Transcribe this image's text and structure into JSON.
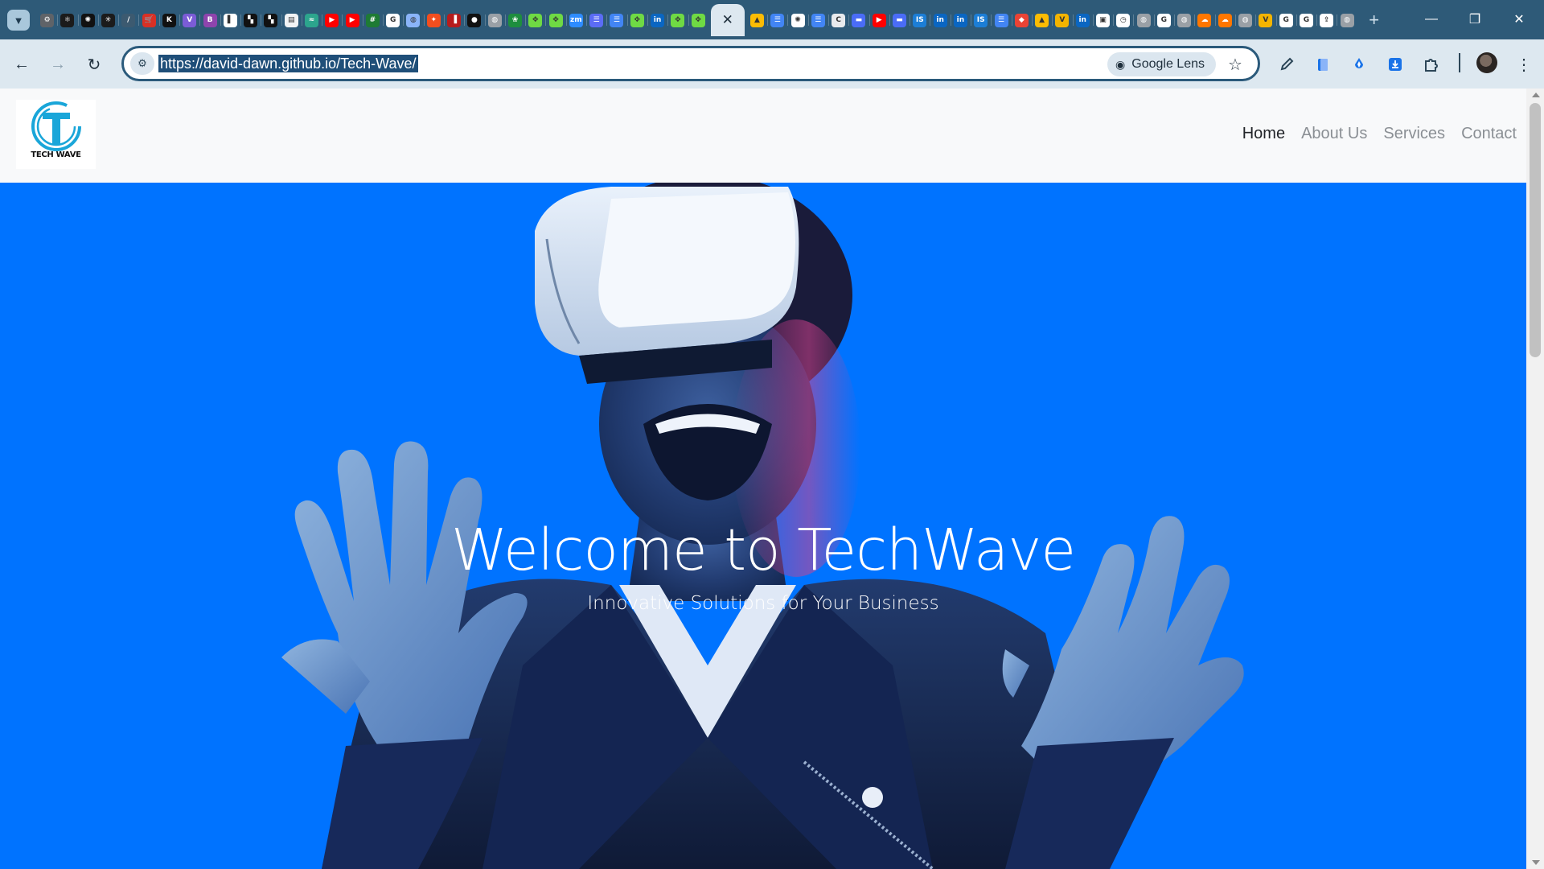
{
  "browser": {
    "pinned_tabs": [
      {
        "icon": "settings-gear-icon",
        "color": "#5f6368",
        "glyph": "⚙"
      },
      {
        "icon": "react-icon",
        "color": "#1b1b1b",
        "glyph": "⚛"
      },
      {
        "icon": "chatgpt-icon",
        "color": "#111111",
        "glyph": "✺"
      },
      {
        "icon": "perplexity-icon",
        "color": "#1b1b1b",
        "glyph": "✳"
      },
      {
        "icon": "slash-icon",
        "color": "#3c5a70",
        "glyph": "/"
      },
      {
        "icon": "shopping-cart-icon",
        "color": "#d93025",
        "glyph": "🛒"
      },
      {
        "icon": "k-icon",
        "color": "#111111",
        "glyph": "K"
      },
      {
        "icon": "v-icon",
        "color": "#7b5cd6",
        "glyph": "V"
      },
      {
        "icon": "b-icon",
        "color": "#8e44ad",
        "glyph": "B"
      },
      {
        "icon": "notion-icon",
        "color": "#ffffff",
        "glyph": "▌"
      },
      {
        "icon": "workspace-icon",
        "color": "#111111",
        "glyph": "▚"
      },
      {
        "icon": "workspace-icon",
        "color": "#111111",
        "glyph": "▚"
      },
      {
        "icon": "document-icon",
        "color": "#f1f3f4",
        "glyph": "▤"
      },
      {
        "icon": "wave-icon",
        "color": "#2ca58d",
        "glyph": "≈"
      },
      {
        "icon": "youtube-icon",
        "color": "#ff0000",
        "glyph": "▶"
      },
      {
        "icon": "youtube-icon",
        "color": "#ff0000",
        "glyph": "▶"
      },
      {
        "icon": "grid-icon",
        "color": "#1e7b34",
        "glyph": "#"
      },
      {
        "icon": "google-icon",
        "color": "#ffffff",
        "glyph": "G"
      },
      {
        "icon": "globe-icon",
        "color": "#8ab4f8",
        "glyph": "◍"
      },
      {
        "icon": "figma-icon",
        "color": "#f24e1e",
        "glyph": "✦"
      },
      {
        "icon": "red-icon",
        "color": "#b71c1c",
        "glyph": "▐"
      },
      {
        "icon": "github-icon",
        "color": "#111111",
        "glyph": "●"
      },
      {
        "icon": "globe-icon",
        "color": "#9aa0a6",
        "glyph": "◍"
      },
      {
        "icon": "leaf-icon",
        "color": "#1e8e3e",
        "glyph": "❀"
      },
      {
        "icon": "upwork-icon",
        "color": "#6fda44",
        "glyph": "✥"
      },
      {
        "icon": "upwork-icon",
        "color": "#6fda44",
        "glyph": "✥"
      },
      {
        "icon": "zoom-icon",
        "color": "#2d8cff",
        "glyph": "zm"
      },
      {
        "icon": "list-icon",
        "color": "#5b6cf5",
        "glyph": "☰"
      },
      {
        "icon": "google-docs-icon",
        "color": "#4285f4",
        "glyph": "☰"
      },
      {
        "icon": "upwork-icon",
        "color": "#6fda44",
        "glyph": "✥"
      },
      {
        "icon": "linkedin-icon",
        "color": "#0a66c2",
        "glyph": "in"
      },
      {
        "icon": "upwork-icon",
        "color": "#6fda44",
        "glyph": "✥"
      },
      {
        "icon": "upwork-icon",
        "color": "#6fda44",
        "glyph": "✥"
      }
    ],
    "pinned_tabs_right": [
      {
        "icon": "google-drive-icon",
        "color": "#fbbc04",
        "glyph": "▲"
      },
      {
        "icon": "google-docs-icon",
        "color": "#4285f4",
        "glyph": "☰"
      },
      {
        "icon": "chatgpt-icon",
        "color": "#ffffff",
        "glyph": "✺"
      },
      {
        "icon": "google-docs-icon",
        "color": "#4285f4",
        "glyph": "☰"
      },
      {
        "icon": "c-icon",
        "color": "#e8eaed",
        "glyph": "C"
      },
      {
        "icon": "bar-icon",
        "color": "#4a6cf7",
        "glyph": "▬"
      },
      {
        "icon": "youtube-icon",
        "color": "#ff0000",
        "glyph": "▶"
      },
      {
        "icon": "bar-icon",
        "color": "#4a6cf7",
        "glyph": "▬"
      },
      {
        "icon": "is-icon",
        "color": "#1c7ed6",
        "glyph": "IS"
      },
      {
        "icon": "linkedin-icon",
        "color": "#0a66c2",
        "glyph": "in"
      },
      {
        "icon": "linkedin-icon",
        "color": "#0a66c2",
        "glyph": "in"
      },
      {
        "icon": "is-icon",
        "color": "#1c7ed6",
        "glyph": "IS"
      },
      {
        "icon": "google-docs-icon",
        "color": "#4285f4",
        "glyph": "☰"
      },
      {
        "icon": "shield-icon",
        "color": "#ea4335",
        "glyph": "◆"
      },
      {
        "icon": "google-drive-icon",
        "color": "#fbbc04",
        "glyph": "▲"
      },
      {
        "icon": "v-icon",
        "color": "#f4b400",
        "glyph": "V"
      },
      {
        "icon": "linkedin-icon",
        "color": "#0a66c2",
        "glyph": "in"
      },
      {
        "icon": "photo-icon",
        "color": "#ffffff",
        "glyph": "▣"
      },
      {
        "icon": "clock-icon",
        "color": "#ffffff",
        "glyph": "◷"
      },
      {
        "icon": "globe-icon",
        "color": "#9aa0a6",
        "glyph": "◍"
      },
      {
        "icon": "google-icon",
        "color": "#ffffff",
        "glyph": "G"
      },
      {
        "icon": "globe-icon",
        "color": "#9aa0a6",
        "glyph": "◍"
      },
      {
        "icon": "soundcloud-icon",
        "color": "#ff7700",
        "glyph": "☁"
      },
      {
        "icon": "soundcloud-icon",
        "color": "#ff7700",
        "glyph": "☁"
      },
      {
        "icon": "globe-icon",
        "color": "#9aa0a6",
        "glyph": "◍"
      },
      {
        "icon": "v-icon",
        "color": "#f4b400",
        "glyph": "V"
      },
      {
        "icon": "google-icon",
        "color": "#ffffff",
        "glyph": "G"
      },
      {
        "icon": "google-icon",
        "color": "#ffffff",
        "glyph": "G"
      },
      {
        "icon": "upload-icon",
        "color": "#ffffff",
        "glyph": "⇪"
      },
      {
        "icon": "globe-icon",
        "color": "#9aa0a6",
        "glyph": "◍"
      }
    ],
    "active_tab_close_glyph": "✕",
    "new_tab_glyph": "+",
    "window_controls": {
      "minimize": "—",
      "restore": "❐",
      "close": "✕"
    },
    "toolbar": {
      "back_glyph": "←",
      "forward_glyph": "→",
      "reload_glyph": "↻",
      "site_info_glyph": "⚙",
      "url": "https://david-dawn.github.io/Tech-Wave/",
      "lens_label": "Google Lens",
      "lens_glyph": "◉",
      "star_glyph": "☆"
    },
    "extensions": [
      {
        "icon": "eyedropper-icon",
        "color": "#2c4658"
      },
      {
        "icon": "bookmark-ext-icon",
        "color": "#1a73e8"
      },
      {
        "icon": "drop-ext-icon",
        "color": "#1a73e8"
      },
      {
        "icon": "download-ext-icon",
        "color": "#1a73e8"
      },
      {
        "icon": "puzzle-icon",
        "color": "#2c4658"
      }
    ]
  },
  "page": {
    "logo_text": "TECH WAVE",
    "nav": [
      {
        "label": "Home",
        "active": true
      },
      {
        "label": "About Us",
        "active": false
      },
      {
        "label": "Services",
        "active": false
      },
      {
        "label": "Contact",
        "active": false
      }
    ],
    "hero": {
      "title": "Welcome to TechWave",
      "subtitle": "Innovative Solutions for Your Business",
      "background_color": "#0073ff"
    }
  }
}
